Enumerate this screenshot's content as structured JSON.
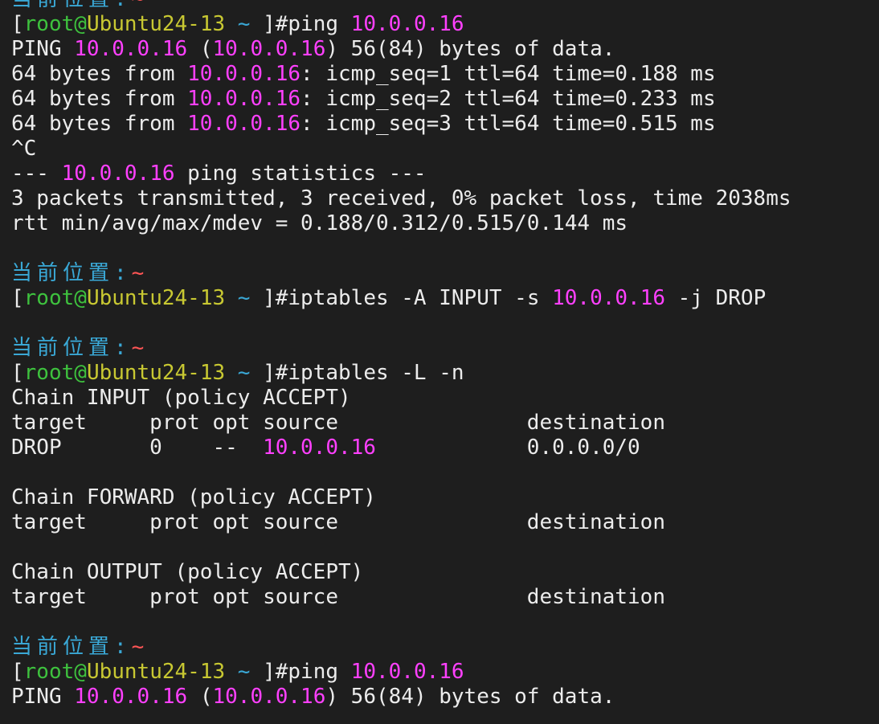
{
  "terminal": {
    "colors": {
      "background": "#1e1e1e",
      "default": "#ececec",
      "ip": "#ff40ff",
      "path_label": "#3aa8d6",
      "tilde": "#ff5555",
      "bracket": "#ececec",
      "user": "#3ec23e",
      "host": "#c8c832",
      "prompt_tail": "#ececec"
    },
    "lines": [
      [
        {
          "t": "当前位置:",
          "c": "path_label",
          "cjk": true
        },
        {
          "t": "~",
          "c": "tilde"
        }
      ],
      [
        {
          "t": "[",
          "c": "bracket"
        },
        {
          "t": "root",
          "c": "user"
        },
        {
          "t": "@",
          "c": "user"
        },
        {
          "t": "Ubuntu24-13",
          "c": "host"
        },
        {
          "t": " ~ ",
          "c": "path_label"
        },
        {
          "t": "]#ping ",
          "c": "prompt_tail"
        },
        {
          "t": "10.0.0.16",
          "c": "ip"
        }
      ],
      [
        {
          "t": "PING ",
          "c": "default"
        },
        {
          "t": "10.0.0.16",
          "c": "ip"
        },
        {
          "t": " (",
          "c": "default"
        },
        {
          "t": "10.0.0.16",
          "c": "ip"
        },
        {
          "t": ") 56(84) bytes of data.",
          "c": "default"
        }
      ],
      [
        {
          "t": "64 bytes from ",
          "c": "default"
        },
        {
          "t": "10.0.0.16",
          "c": "ip"
        },
        {
          "t": ": icmp_seq=1 ttl=64 time=0.188 ms",
          "c": "default"
        }
      ],
      [
        {
          "t": "64 bytes from ",
          "c": "default"
        },
        {
          "t": "10.0.0.16",
          "c": "ip"
        },
        {
          "t": ": icmp_seq=2 ttl=64 time=0.233 ms",
          "c": "default"
        }
      ],
      [
        {
          "t": "64 bytes from ",
          "c": "default"
        },
        {
          "t": "10.0.0.16",
          "c": "ip"
        },
        {
          "t": ": icmp_seq=3 ttl=64 time=0.515 ms",
          "c": "default"
        }
      ],
      [
        {
          "t": "^C",
          "c": "default"
        }
      ],
      [
        {
          "t": "--- ",
          "c": "default"
        },
        {
          "t": "10.0.0.16",
          "c": "ip"
        },
        {
          "t": " ping statistics ---",
          "c": "default"
        }
      ],
      [
        {
          "t": "3 packets transmitted, 3 received, 0% packet loss, time 2038ms",
          "c": "default"
        }
      ],
      [
        {
          "t": "rtt min/avg/max/mdev = 0.188/0.312/0.515/0.144 ms",
          "c": "default"
        }
      ],
      [],
      [
        {
          "t": "当前位置:",
          "c": "path_label",
          "cjk": true
        },
        {
          "t": "~",
          "c": "tilde"
        }
      ],
      [
        {
          "t": "[",
          "c": "bracket"
        },
        {
          "t": "root",
          "c": "user"
        },
        {
          "t": "@",
          "c": "user"
        },
        {
          "t": "Ubuntu24-13",
          "c": "host"
        },
        {
          "t": " ~ ",
          "c": "path_label"
        },
        {
          "t": "]#iptables -A INPUT -s ",
          "c": "prompt_tail"
        },
        {
          "t": "10.0.0.16",
          "c": "ip"
        },
        {
          "t": " -j DROP",
          "c": "default"
        }
      ],
      [],
      [
        {
          "t": "当前位置:",
          "c": "path_label",
          "cjk": true
        },
        {
          "t": "~",
          "c": "tilde"
        }
      ],
      [
        {
          "t": "[",
          "c": "bracket"
        },
        {
          "t": "root",
          "c": "user"
        },
        {
          "t": "@",
          "c": "user"
        },
        {
          "t": "Ubuntu24-13",
          "c": "host"
        },
        {
          "t": " ~ ",
          "c": "path_label"
        },
        {
          "t": "]#iptables -L -n",
          "c": "prompt_tail"
        }
      ],
      [
        {
          "t": "Chain INPUT (policy ACCEPT)",
          "c": "default"
        }
      ],
      [
        {
          "t": "target     prot opt source               destination",
          "c": "default"
        }
      ],
      [
        {
          "t": "DROP       0    --  ",
          "c": "default"
        },
        {
          "t": "10.0.0.16",
          "c": "ip"
        },
        {
          "t": "            0.0.0.0/0",
          "c": "default"
        }
      ],
      [],
      [
        {
          "t": "Chain FORWARD (policy ACCEPT)",
          "c": "default"
        }
      ],
      [
        {
          "t": "target     prot opt source               destination",
          "c": "default"
        }
      ],
      [],
      [
        {
          "t": "Chain OUTPUT (policy ACCEPT)",
          "c": "default"
        }
      ],
      [
        {
          "t": "target     prot opt source               destination",
          "c": "default"
        }
      ],
      [],
      [
        {
          "t": "当前位置:",
          "c": "path_label",
          "cjk": true
        },
        {
          "t": "~",
          "c": "tilde"
        }
      ],
      [
        {
          "t": "[",
          "c": "bracket"
        },
        {
          "t": "root",
          "c": "user"
        },
        {
          "t": "@",
          "c": "user"
        },
        {
          "t": "Ubuntu24-13",
          "c": "host"
        },
        {
          "t": " ~ ",
          "c": "path_label"
        },
        {
          "t": "]#ping ",
          "c": "prompt_tail"
        },
        {
          "t": "10.0.0.16",
          "c": "ip"
        }
      ],
      [
        {
          "t": "PING ",
          "c": "default"
        },
        {
          "t": "10.0.0.16",
          "c": "ip"
        },
        {
          "t": " (",
          "c": "default"
        },
        {
          "t": "10.0.0.16",
          "c": "ip"
        },
        {
          "t": ") 56(84) bytes of data.",
          "c": "default"
        }
      ]
    ]
  }
}
